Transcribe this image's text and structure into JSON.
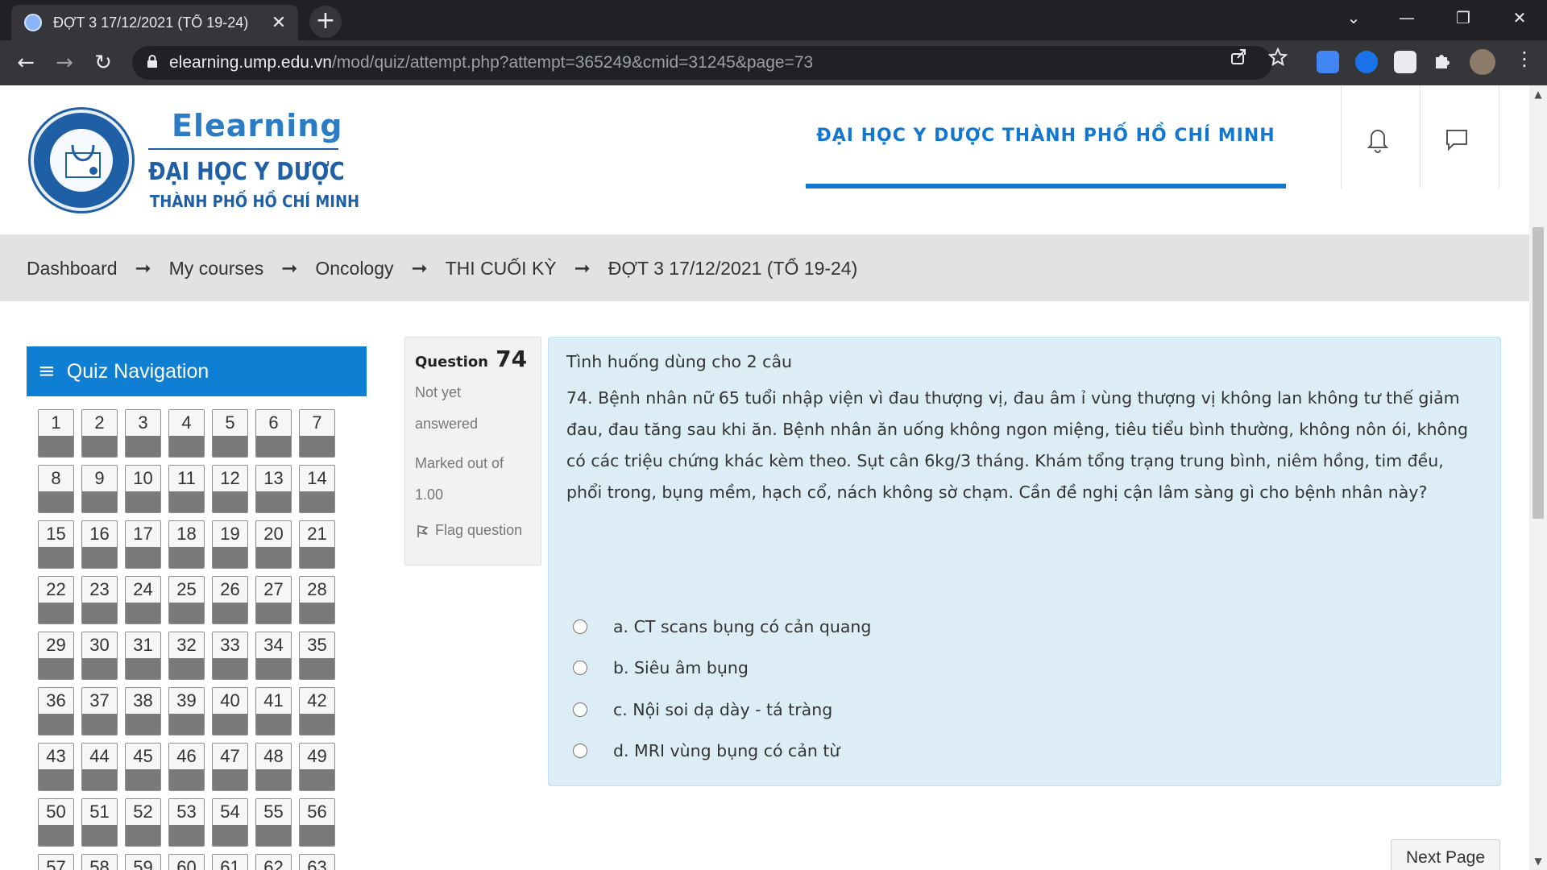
{
  "browser": {
    "tab_title": "ĐỢT 3 17/12/2021 (TỔ 19-24)",
    "close_glyph": "✕",
    "newtab_glyph": "+",
    "url_host": "elearning.ump.edu.vn",
    "url_path": "/mod/quiz/attempt.php?attempt=365249&cmid=31245&page=73",
    "window_controls": {
      "dropdown": "⌄",
      "minimize": "—",
      "restore": "❐",
      "close": "✕"
    },
    "nav": {
      "back": "←",
      "forward": "→",
      "reload": "↻"
    }
  },
  "header": {
    "logo_title": "Elearning",
    "logo_line1": "ĐẠI HỌC Y DƯỢC",
    "logo_line2": "THÀNH PHỐ HỒ CHÍ MINH",
    "site_title": "ĐẠI HỌC Y DƯỢC THÀNH PHỐ HỒ CHÍ MINH",
    "accent_color": "#1177d1"
  },
  "breadcrumb": {
    "separator": "➞",
    "items": [
      "Dashboard",
      "My courses",
      "Oncology",
      "THI CUỐI KỲ",
      "ĐỢT 3 17/12/2021 (TỔ 19-24)"
    ]
  },
  "quiz_nav": {
    "title": "Quiz Navigation",
    "menu_glyph": "≡",
    "questions": [
      "1",
      "2",
      "3",
      "4",
      "5",
      "6",
      "7",
      "8",
      "9",
      "10",
      "11",
      "12",
      "13",
      "14",
      "15",
      "16",
      "17",
      "18",
      "19",
      "20",
      "21",
      "22",
      "23",
      "24",
      "25",
      "26",
      "27",
      "28",
      "29",
      "30",
      "31",
      "32",
      "33",
      "34",
      "35",
      "36",
      "37",
      "38",
      "39",
      "40",
      "41",
      "42",
      "43",
      "44",
      "45",
      "46",
      "47",
      "48",
      "49",
      "50",
      "51",
      "52",
      "53",
      "54",
      "55",
      "56",
      "57",
      "58",
      "59",
      "60",
      "61",
      "62",
      "63"
    ]
  },
  "question": {
    "label": "Question",
    "number": "74",
    "state_line1": "Not yet",
    "state_line2": "answered",
    "grade_line1": "Marked out of",
    "grade_line2": "1.00",
    "flag_label": "Flag question",
    "intro": "Tình huống dùng cho 2 câu",
    "text": "74. Bệnh nhân nữ 65 tuổi nhập viện vì đau thượng vị, đau âm ỉ vùng thượng vị không lan không tư thế giảm đau, đau tăng sau khi ăn. Bệnh nhân ăn uống không ngon miệng, tiêu tiểu bình thường, không nôn ói, không có các triệu chứng khác kèm theo. Sụt cân 6kg/3 tháng. Khám tổng trạng trung bình, niêm hồng, tim đều, phổi trong, bụng mềm, hạch cổ, nách không sờ chạm. Cần đề nghị cận lâm sàng gì cho bệnh nhân này?",
    "answers": [
      "a. CT scans bụng có cản quang",
      "b. Siêu âm bụng",
      "c. Nội soi dạ dày - tá tràng",
      "d. MRI vùng bụng có cản từ"
    ]
  },
  "next_button": "Next Page"
}
